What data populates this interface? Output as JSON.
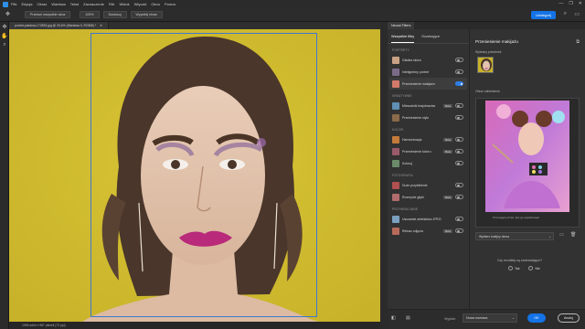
{
  "menubar": {
    "items": [
      "Plik",
      "Edycja",
      "Obraz",
      "Warstwa",
      "Tekst",
      "Zaznaczenie",
      "Filtr",
      "Widok",
      "Wtyczki",
      "Okno",
      "Pomoc"
    ],
    "window_controls": [
      "—",
      "❐",
      "✕"
    ]
  },
  "options": {
    "buttons": [
      "Przesuń wszystkie okna",
      "100%",
      "Dostosuj",
      "Wypełnij ekran"
    ],
    "share_label": "Udostępnij"
  },
  "document": {
    "tab_title": "portret-piankna-172833.jpg @ 25,6% (Warstwa 0, RGB/8) *",
    "status": "1096 sdim x 987 pikseli (72 ppi)"
  },
  "neural": {
    "panel_tab": "Neural Filters",
    "tabs": [
      "Wszystkie filtry",
      "Oczekujące"
    ],
    "categories": [
      {
        "name": "PORTRETY",
        "items": [
          {
            "label": "Gładka skóra",
            "beta": false,
            "cloud": false,
            "on": false,
            "color": "#c9a184"
          },
          {
            "label": "Inteligentny portret",
            "beta": false,
            "cloud": false,
            "on": false,
            "color": "#7a6a88"
          },
          {
            "label": "Przeniesienie makijażu",
            "beta": false,
            "cloud": false,
            "on": true,
            "color": "#d27a6a",
            "selected": true
          }
        ]
      },
      {
        "name": "KREATYWNE",
        "items": [
          {
            "label": "Mieszalnik krajobrazów",
            "beta": true,
            "cloud": false,
            "on": false,
            "color": "#5f8fb4"
          },
          {
            "label": "Przeniesienie stylu",
            "beta": false,
            "cloud": false,
            "on": false,
            "color": "#8a6a4a"
          }
        ]
      },
      {
        "name": "KOLOR",
        "items": [
          {
            "label": "Harmonizacja",
            "beta": true,
            "cloud": false,
            "on": false,
            "color": "#c47a3a"
          },
          {
            "label": "Przeniesienie koloru",
            "beta": true,
            "cloud": false,
            "on": false,
            "color": "#9a5a6a"
          },
          {
            "label": "Koloruj",
            "beta": false,
            "cloud": false,
            "on": false,
            "color": "#6a8a6a"
          }
        ]
      },
      {
        "name": "FOTOGRAFIA",
        "items": [
          {
            "label": "Duże przybliżenie",
            "beta": false,
            "cloud": false,
            "on": false,
            "color": "#b05050"
          },
          {
            "label": "Rozmycie głębi",
            "beta": true,
            "cloud": false,
            "on": false,
            "color": "#b06c6c"
          }
        ]
      },
      {
        "name": "PRZYWRACANIE",
        "items": [
          {
            "label": "Usuwanie artefaktów JPEG",
            "beta": false,
            "cloud": false,
            "on": false,
            "color": "#7aa0c0"
          },
          {
            "label": "Retusz zdjęcia",
            "beta": true,
            "cloud": false,
            "on": false,
            "color": "#b86a5a"
          }
        ]
      }
    ],
    "right": {
      "title": "Przeniesienie makijażu",
      "subject_label": "Wybrany przedmiot",
      "ref_label": "Obraz odniesienia",
      "ref_caption": "Przeciągnij obraz, aby go wykadrować",
      "select_label": "Wybierz kolejny obraz",
      "question": "Czy rezultaty są zadowalające?",
      "yes": "Tak",
      "no": "Nie"
    },
    "footer": {
      "output_label": "Wyjście",
      "output_value": "Nowa warstwa",
      "ok": "OK",
      "cancel": "Anuluj"
    }
  },
  "colors": {
    "accent": "#1473e6",
    "canvas_bg": "#d4bf2f",
    "frame": "#3f78d1"
  }
}
